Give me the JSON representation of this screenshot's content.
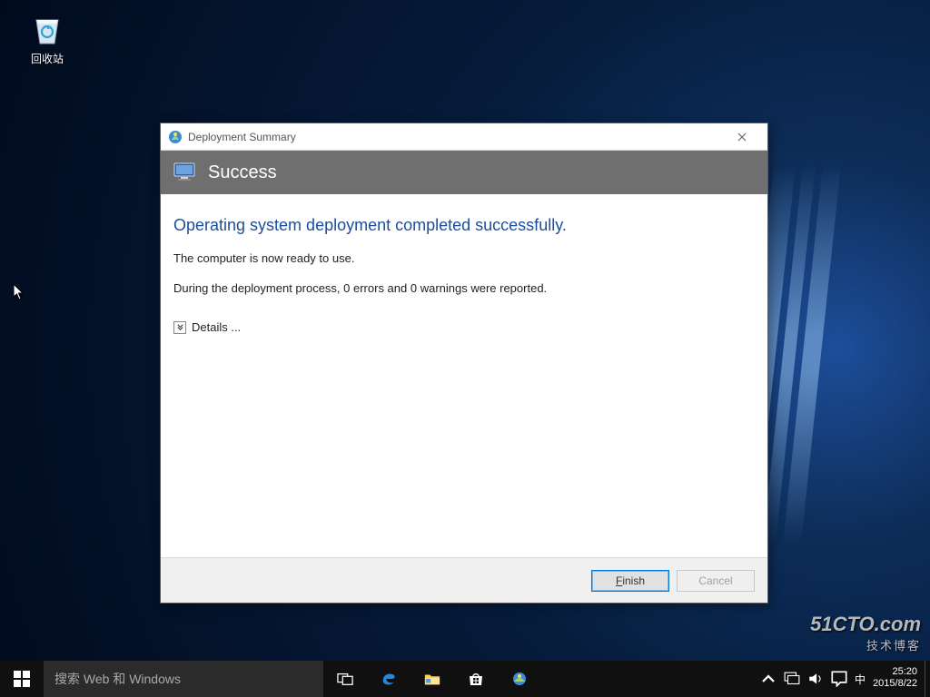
{
  "desktop": {
    "recycle_bin_label": "回收站"
  },
  "dialog": {
    "title": "Deployment Summary",
    "banner": "Success",
    "headline": "Operating system deployment completed successfully.",
    "line_ready": "The computer is now ready to use.",
    "line_report": "During the deployment process, 0 errors and 0 warnings were reported.",
    "details_label": "Details ...",
    "finish_label": "Finish",
    "cancel_label": "Cancel"
  },
  "taskbar": {
    "search_placeholder": "搜索 Web 和 Windows",
    "ime_label": "中"
  },
  "tray": {
    "time": "25:20",
    "date": "2015/8/22"
  },
  "watermark": {
    "line1": "51CTO.com",
    "line2": "技术博客"
  }
}
